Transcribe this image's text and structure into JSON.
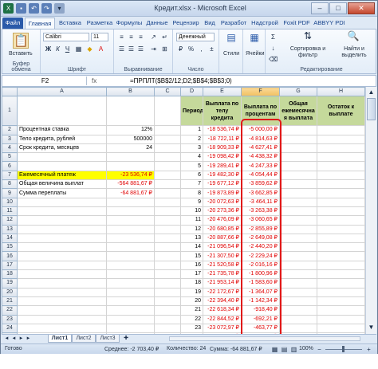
{
  "window": {
    "title": "Кредит.xlsx - Microsoft Excel",
    "controls": [
      "–",
      "□",
      "✕"
    ]
  },
  "tabs": [
    {
      "label": "Файл",
      "kind": "file"
    },
    {
      "label": "Главная",
      "kind": "active"
    },
    {
      "label": "Вставка",
      "kind": ""
    },
    {
      "label": "Разметка",
      "kind": ""
    },
    {
      "label": "Формулы",
      "kind": ""
    },
    {
      "label": "Данные",
      "kind": ""
    },
    {
      "label": "Рецензир",
      "kind": ""
    },
    {
      "label": "Вид",
      "kind": ""
    },
    {
      "label": "Разработ",
      "kind": ""
    },
    {
      "label": "Надстрой",
      "kind": ""
    },
    {
      "label": "Foxit PDF",
      "kind": ""
    },
    {
      "label": "ABBYY PDI",
      "kind": ""
    }
  ],
  "ribbon": {
    "clipboard": {
      "paste": "Вставить",
      "group": "Буфер обмена"
    },
    "font": {
      "name": "Calibri",
      "size": "11",
      "group": "Шрифт"
    },
    "alignment": {
      "group": "Выравнивание"
    },
    "number": {
      "format": "Денежный",
      "group": "Число"
    },
    "styles": {
      "label": "Стили"
    },
    "cells": {
      "label": "Ячейки"
    },
    "editing": {
      "sort": "Сортировка и фильтр",
      "find": "Найти и выделить",
      "group": "Редактирование"
    }
  },
  "formula_bar": {
    "name_box": "F2",
    "fx": "fx",
    "formula": "=ПРПЛТ($B$2/12;D2;$B$4;$B$3;0)"
  },
  "columns": [
    "A",
    "B",
    "C",
    "D",
    "E",
    "F",
    "G",
    "H"
  ],
  "header_row": {
    "D": "Период",
    "E": "Выплата по телу кредита",
    "F": "Выплата по процентам",
    "G": "Общая ежемесячна я выплата",
    "H": "Остаток к выплате"
  },
  "left_block": [
    {
      "row": "2",
      "label": "Процентная ставка",
      "value": "12%"
    },
    {
      "row": "3",
      "label": "Тело кредита, рублей",
      "value": "500000"
    },
    {
      "row": "4",
      "label": "Срок кредита, месяцев",
      "value": "24"
    },
    {
      "row": "7",
      "label": "Ежемесячный платеж",
      "value": "-23 536,74 ₽"
    },
    {
      "row": "8",
      "label": "Общая величина выплат",
      "value": "-564 881,67 ₽"
    },
    {
      "row": "9",
      "label": "Сумма переплаты",
      "value": "-64 881,67 ₽"
    }
  ],
  "rows": [
    {
      "n": "2",
      "period": "1",
      "principal": "-18 536,74 ₽",
      "interest": "-5 000,00 ₽"
    },
    {
      "n": "3",
      "period": "2",
      "principal": "-18 722,11 ₽",
      "interest": "-4 814,63 ₽"
    },
    {
      "n": "4",
      "period": "3",
      "principal": "-18 909,33 ₽",
      "interest": "-4 627,41 ₽"
    },
    {
      "n": "5",
      "period": "4",
      "principal": "-19 098,42 ₽",
      "interest": "-4 438,32 ₽"
    },
    {
      "n": "6",
      "period": "5",
      "principal": "-19 289,41 ₽",
      "interest": "-4 247,33 ₽"
    },
    {
      "n": "7",
      "period": "6",
      "principal": "-19 482,30 ₽",
      "interest": "-4 054,44 ₽"
    },
    {
      "n": "8",
      "period": "7",
      "principal": "-19 677,12 ₽",
      "interest": "-3 859,62 ₽"
    },
    {
      "n": "9",
      "period": "8",
      "principal": "-19 873,89 ₽",
      "interest": "-3 662,85 ₽"
    },
    {
      "n": "10",
      "period": "9",
      "principal": "-20 072,63 ₽",
      "interest": "-3 464,11 ₽"
    },
    {
      "n": "11",
      "period": "10",
      "principal": "-20 273,36 ₽",
      "interest": "-3 263,38 ₽"
    },
    {
      "n": "12",
      "period": "11",
      "principal": "-20 476,09 ₽",
      "interest": "-3 060,65 ₽"
    },
    {
      "n": "13",
      "period": "12",
      "principal": "-20 680,85 ₽",
      "interest": "-2 855,89 ₽"
    },
    {
      "n": "14",
      "period": "13",
      "principal": "-20 887,66 ₽",
      "interest": "-2 649,08 ₽"
    },
    {
      "n": "15",
      "period": "14",
      "principal": "-21 096,54 ₽",
      "interest": "-2 440,20 ₽"
    },
    {
      "n": "16",
      "period": "15",
      "principal": "-21 307,50 ₽",
      "interest": "-2 229,24 ₽"
    },
    {
      "n": "17",
      "period": "16",
      "principal": "-21 520,58 ₽",
      "interest": "-2 016,16 ₽"
    },
    {
      "n": "18",
      "period": "17",
      "principal": "-21 735,78 ₽",
      "interest": "-1 800,96 ₽"
    },
    {
      "n": "19",
      "period": "18",
      "principal": "-21 953,14 ₽",
      "interest": "-1 583,60 ₽"
    },
    {
      "n": "20",
      "period": "19",
      "principal": "-22 172,67 ₽",
      "interest": "-1 364,07 ₽"
    },
    {
      "n": "21",
      "period": "20",
      "principal": "-22 394,40 ₽",
      "interest": "-1 142,34 ₽"
    },
    {
      "n": "22",
      "period": "21",
      "principal": "-22 618,34 ₽",
      "interest": "-918,40 ₽"
    },
    {
      "n": "23",
      "period": "22",
      "principal": "-22 844,52 ₽",
      "interest": "-692,21 ₽"
    },
    {
      "n": "24",
      "period": "23",
      "principal": "-23 072,97 ₽",
      "interest": "-463,77 ₽"
    },
    {
      "n": "25",
      "period": "24",
      "principal": "-23 303,70 ₽",
      "interest": "-233,04 ₽"
    }
  ],
  "sheet_tabs": [
    "Лист1",
    "Лист2",
    "Лист3"
  ],
  "status": {
    "ready": "Готово",
    "average": "Среднее: -2 703,40 ₽",
    "count": "Количество: 24",
    "sum": "Сумма: -64 881,67 ₽",
    "zoom": "100%"
  },
  "colors": {
    "accent": "#2a5aa9",
    "header_green": "#c5d99b",
    "highlight_yellow": "#ffff00",
    "negative_red": "#e00000",
    "annotation_red": "#e01818"
  }
}
